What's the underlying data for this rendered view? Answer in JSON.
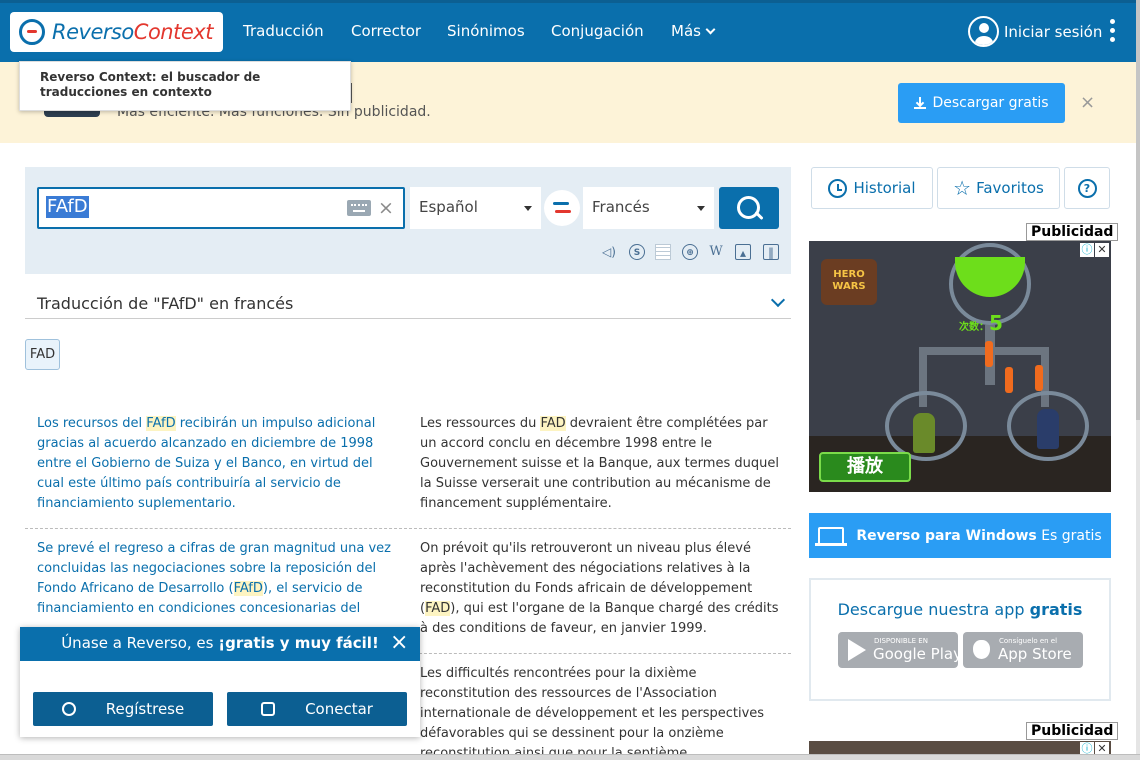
{
  "header": {
    "logo_a": "Reverso",
    "logo_b": "Context",
    "nav": [
      "Traducción",
      "Corrector",
      "Sinónimos",
      "Conjugación",
      "Más"
    ],
    "login": "Iniciar sesión"
  },
  "tooltip": "Reverso Context: el buscador de traducciones en contexto",
  "banner": {
    "subtitle": "Más eficiente. Más funciones. Sin publicidad.",
    "download": "Descargar gratis",
    "close": "×"
  },
  "search": {
    "query": "FAfD",
    "clear": "×",
    "source_lang": "Español",
    "target_lang": "Francés",
    "tools": [
      "speaker-icon",
      "s-circle-icon",
      "grid-icon",
      "globe-icon",
      "wikipedia-icon",
      "image-icon",
      "book-icon"
    ]
  },
  "results": {
    "title": "Traducción de \"FAfD\" en francés",
    "chip": "FAD",
    "examples": [
      {
        "src": [
          [
            "Los recursos del ",
            0
          ],
          [
            "FAfD",
            1
          ],
          [
            " recibirán un impulso adicional gracias al acuerdo alcanzado en diciembre de 1998 entre el Gobierno de Suiza y el Banco, en virtud del cual este último país contribuiría al servicio de financiamiento suplementario.",
            0
          ]
        ],
        "tgt": [
          [
            "Les ressources du ",
            0
          ],
          [
            "FAD",
            1
          ],
          [
            " devraient être complétées par un accord conclu en décembre 1998 entre le Gouvernement suisse et la Banque, aux termes duquel la Suisse verserait une contribution au mécanisme de financement supplémentaire.",
            0
          ]
        ]
      },
      {
        "src": [
          [
            "Se prevé el regreso a cifras de gran magnitud una vez concluidas las negociaciones sobre la reposición del Fondo Africano de Desarrollo (",
            0
          ],
          [
            "FAfD",
            1
          ],
          [
            "), el servicio de financiamiento en condiciones concesionarias del ",
            0
          ]
        ],
        "tgt": [
          [
            "On prévoit qu'ils retrouveront un niveau plus élevé après l'achèvement des négociations relatives à la reconstitution du Fonds africain de développement (",
            0
          ],
          [
            "FAD",
            1
          ],
          [
            "), qui est l'organe de la Banque chargé des crédits à des conditions de faveur, en janvier 1999.",
            0
          ]
        ]
      },
      {
        "src": [],
        "tgt": [
          [
            "Les difficultés rencontrées pour la dixième reconstitution des ressources de l'Association internationale de développement et les perspectives défavorables qui se dessinent pour la onzième reconstitution ainsi que pour la septième",
            0
          ]
        ]
      }
    ]
  },
  "sidebar": {
    "history": "Historial",
    "favorites": "Favoritos",
    "ad_label": "Publicidad",
    "ad_game": "HERO WARS",
    "ad_number_label": "次数：",
    "ad_number": "5",
    "ad_play": "播放",
    "windows_bold": "Reverso para Windows",
    "windows_free": " Es gratis",
    "app_title": "Descargue nuestra app ",
    "app_title_bold": "gratis",
    "google_small": "DISPONIBLE EN",
    "google_big": "Google Play",
    "apple_small": "Consíguelo en el",
    "apple_big": "App Store"
  },
  "join": {
    "title_a": "Únase a Reverso, es ",
    "title_b": "¡gratis y muy fácil!",
    "register": "Regístrese",
    "connect": "Conectar",
    "close": "×"
  },
  "colors": {
    "brand_blue": "#0a6fac",
    "accent_blue": "#2a9df4",
    "brand_red": "#e3372e",
    "highlight": "#fdf4c2"
  }
}
